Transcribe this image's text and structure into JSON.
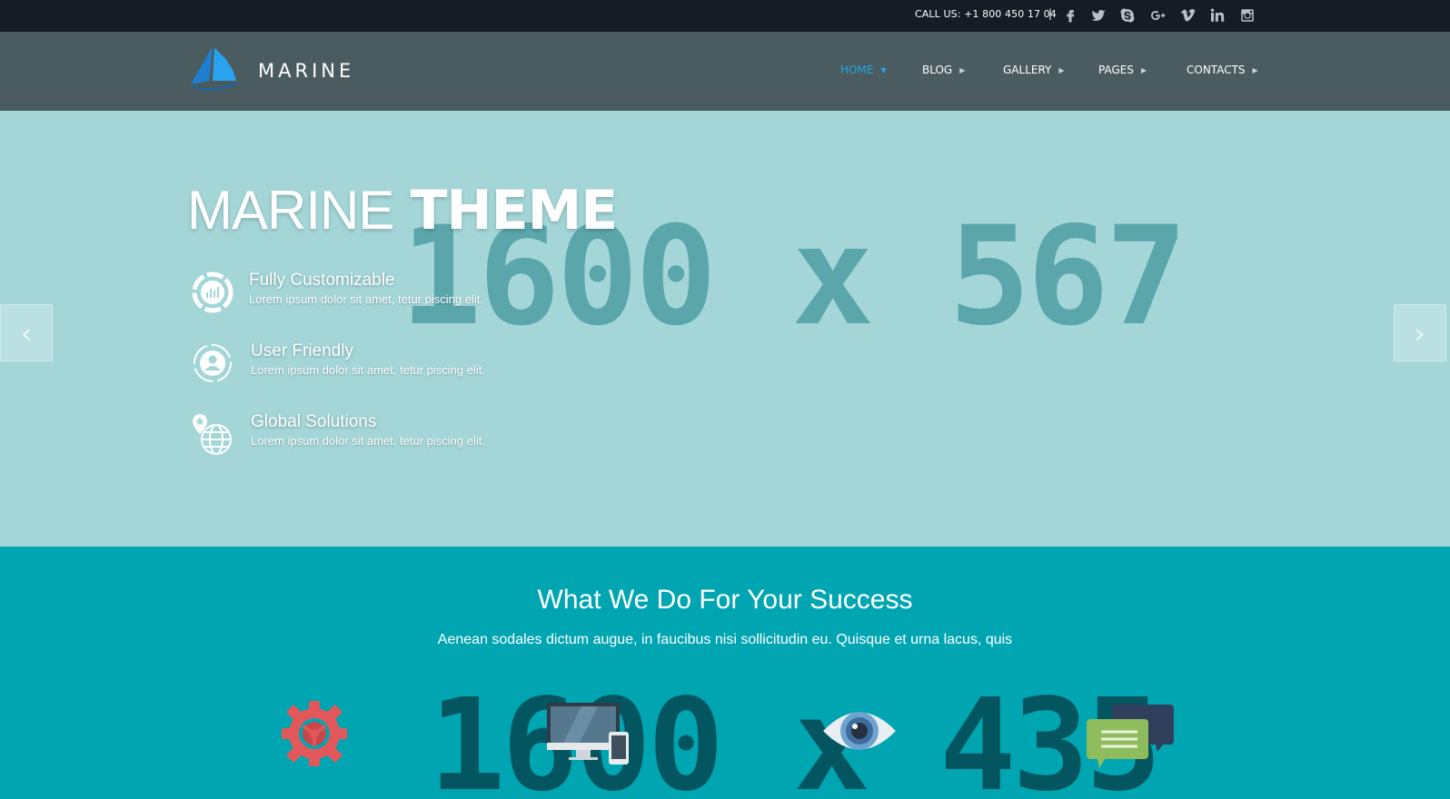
{
  "topbar": {
    "phone": "CALL US: +1 800 450 17 04",
    "separator": "|",
    "social": [
      "facebook-icon",
      "twitter-icon",
      "skype-icon",
      "google-plus-icon",
      "vimeo-icon",
      "linkedin-icon",
      "instagram-icon"
    ]
  },
  "header": {
    "logo_text": "MARINE",
    "nav": [
      {
        "label": "HOME",
        "active": true
      },
      {
        "label": "BLOG",
        "active": false
      },
      {
        "label": "GALLERY",
        "active": false
      },
      {
        "label": "PAGES",
        "active": false
      },
      {
        "label": "CONTACTS",
        "active": false
      }
    ]
  },
  "hero": {
    "placeholder": "1600 x 567",
    "title_light": "MARINE",
    "title_bold": "THEME",
    "features": [
      {
        "title": "Fully Customizable",
        "desc": "Lorem ipsum dolor sit amet, tetur piscing elit.",
        "icon": "chart-ring-icon"
      },
      {
        "title": "User Friendly",
        "desc": "Lorem ipsum dolor sit amet, tetur piscing elit.",
        "icon": "user-cycle-icon"
      },
      {
        "title": "Global Solutions",
        "desc": "Lorem ipsum dolor sit amet, tetur piscing elit.",
        "icon": "globe-pin-icon"
      }
    ],
    "prev_label": "‹",
    "next_label": "›"
  },
  "services": {
    "title": "What We Do For Your Success",
    "subtitle": "Aenean sodales dictum augue, in faucibus nisi sollicitudin eu. Quisque et urna lacus, quis",
    "placeholder": "1600 x 435",
    "icons": [
      "gear-icon",
      "devices-icon",
      "eye-icon",
      "chat-bubbles-icon"
    ]
  },
  "colors": {
    "topbar": "#151c26",
    "header": "#4b5c60",
    "hero": "#a4d6d8",
    "services": "#00a5b2",
    "accent": "#1ea8e8"
  }
}
